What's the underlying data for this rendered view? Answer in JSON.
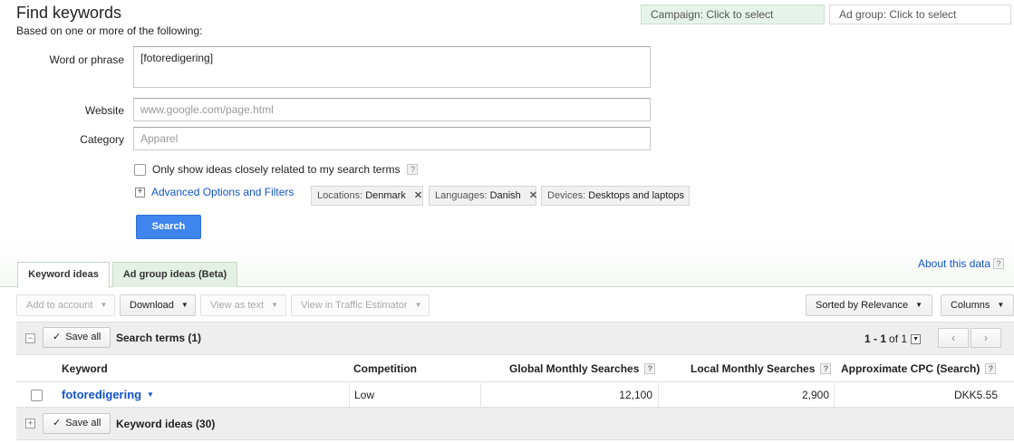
{
  "header": {
    "title": "Find keywords",
    "subtitle": "Based on one or more of the following:",
    "campaign_selector": "Campaign: Click to select",
    "adgroup_selector": "Ad group: Click to select"
  },
  "form": {
    "word_label": "Word or phrase",
    "word_value": "[fotoredigering]",
    "website_label": "Website",
    "website_placeholder": "www.google.com/page.html",
    "category_label": "Category",
    "category_placeholder": "Apparel",
    "closely_related_label": "Only show ideas closely related to my search terms",
    "advanced_link": "Advanced Options and Filters",
    "chips": {
      "location_key": "Locations:",
      "location_value": "Denmark",
      "language_key": "Languages:",
      "language_value": "Danish",
      "device_key": "Devices:",
      "device_value": "Desktops and laptops"
    },
    "search_button": "Search"
  },
  "tabs": {
    "keyword_ideas": "Keyword ideas",
    "ad_group_ideas": "Ad group ideas (Beta)",
    "about_link": "About this data"
  },
  "toolbar": {
    "add_to_account": "Add to account",
    "download": "Download",
    "view_as_text": "View as text",
    "view_traffic": "View in Traffic Estimator",
    "sorted": "Sorted by Relevance",
    "columns": "Columns"
  },
  "table": {
    "save_all": "Save all",
    "search_terms_title": "Search terms (1)",
    "keyword_ideas_title": "Keyword ideas (30)",
    "pager_range": "1 - 1",
    "pager_of": "of 1",
    "columns": {
      "keyword": "Keyword",
      "competition": "Competition",
      "global": "Global Monthly Searches",
      "local": "Local Monthly Searches",
      "cpc": "Approximate CPC (Search)"
    },
    "rows": [
      {
        "keyword": "fotoredigering",
        "competition": "Low",
        "global": "12,100",
        "local": "2,900",
        "cpc": "DKK5.55"
      }
    ]
  },
  "icons": {
    "help": "question-mark-icon",
    "close": "x-icon",
    "expand": "plus-box-icon",
    "collapse": "minus-box-icon",
    "dropdown": "caret-down-icon",
    "check": "checkmark-icon"
  },
  "colors": {
    "link": "#1155cc",
    "search_button": "#3e85ed",
    "campaign_bg": "#e6f3ea",
    "tab_inactive_bg": "#e5f0e5"
  }
}
